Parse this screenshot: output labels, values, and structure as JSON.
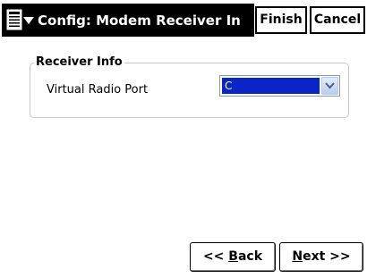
{
  "titlebar": {
    "title": "Config: Modem Receiver In",
    "menu_icon": "menu-icon",
    "finish_label": "Finish",
    "cancel_label": "Cancel"
  },
  "group": {
    "title": "Receiver Info",
    "field_label": "Virtual Radio Port",
    "combo_value": "C"
  },
  "nav": {
    "back_prefix": "<< ",
    "back_ul": "B",
    "back_rest": "ack",
    "next_ul": "N",
    "next_rest": "ext >>"
  },
  "colors": {
    "titlebar_bg": "#000000",
    "selection": "#0a24c8",
    "combo_border": "#7f9db9",
    "groupbox_border": "#c9c9c9"
  }
}
